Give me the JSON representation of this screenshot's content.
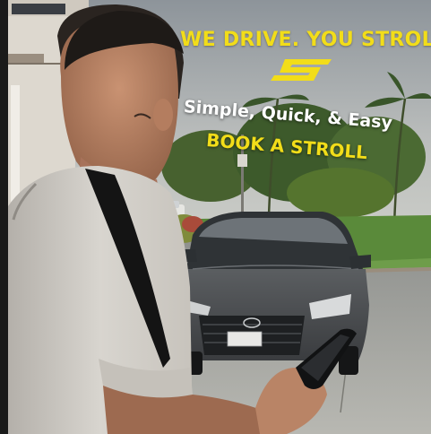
{
  "ad": {
    "headline": "WE DRIVE. YOU STROLL.",
    "tagline": "Simple, Quick, & Easy",
    "cta": "BOOK A STROLL"
  },
  "colors": {
    "brand_yellow": "#f2dd19",
    "tagline_white": "#ffffff"
  },
  "icons": {
    "logo": "stroll-s-logo-icon"
  }
}
